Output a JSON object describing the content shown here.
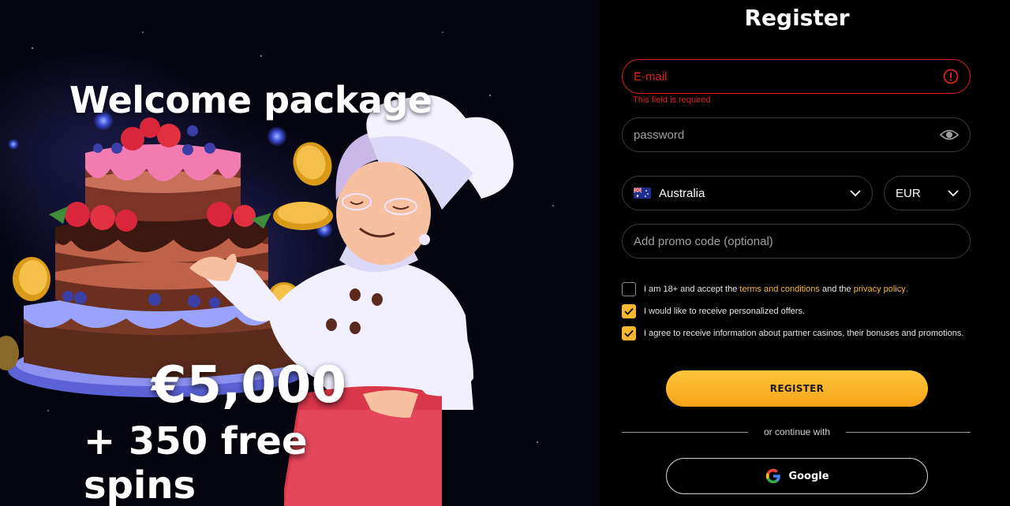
{
  "promo": {
    "title": "Welcome package",
    "amount": "€5,000",
    "spins": "+ 350 free spins"
  },
  "form": {
    "title": "Register",
    "email": {
      "placeholder": "E-mail",
      "error": "This field is required"
    },
    "password": {
      "placeholder": "password"
    },
    "country": {
      "value": "Australia",
      "flag": "australia-flag-icon"
    },
    "currency": {
      "value": "EUR"
    },
    "promo_code": {
      "placeholder": "Add promo code (optional)"
    },
    "checkboxes": [
      {
        "checked": false,
        "text_before": "I am 18+ and accept the ",
        "link1": "terms and conditions",
        "text_middle": " and the ",
        "link2": "privacy policy",
        "text_after": "."
      },
      {
        "checked": true,
        "text": "I would like to receive personalized offers."
      },
      {
        "checked": true,
        "text": "I agree to receive information about partner casinos, their bonuses and promotions."
      }
    ],
    "register_label": "REGISTER",
    "divider_text": "or continue with",
    "google_label": "Google"
  },
  "colors": {
    "accent": "#f7b731",
    "error": "#e0201a",
    "background": "#000000"
  }
}
